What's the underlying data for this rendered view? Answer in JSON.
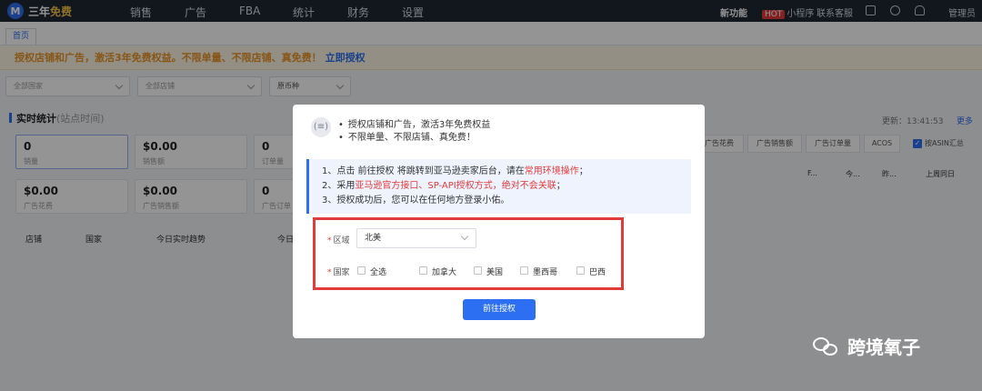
{
  "header": {
    "logo_mark": "M",
    "logo_text_a": "三年",
    "logo_text_b": "免费",
    "nav": [
      "销售",
      "广告",
      "FBA",
      "统计",
      "财务",
      "设置"
    ],
    "new_feature": "新功能",
    "hot_badge": "HOT",
    "mini_program": "小程序",
    "customer_service": "联系客服",
    "user": "管理员"
  },
  "tabs": [
    {
      "label": "首页"
    }
  ],
  "banner": {
    "text": "授权店铺和广告，激活3年免费权益。不限单量、不限店铺、真免费！",
    "link": "立即授权"
  },
  "filters": {
    "country": "全部国家",
    "store": "全部店铺",
    "currency": "原币种"
  },
  "stats": {
    "title": "实时统计",
    "subtitle": "(站点时间)",
    "cards": [
      {
        "value": "0",
        "label": "销量"
      },
      {
        "value": "$0.00",
        "label": "销售额"
      },
      {
        "value": "0",
        "label": "订单量"
      },
      {
        "value": "$0.00",
        "label": "广告花费"
      },
      {
        "value": "$0.00",
        "label": "广告销售额"
      },
      {
        "value": "0",
        "label": "广告订单"
      }
    ],
    "table_headers": [
      "店铺",
      "国家",
      "今日实时趋势",
      "今日"
    ]
  },
  "right_panel": {
    "update_label": "更新：",
    "update_time": "13:41:53",
    "more": "更多",
    "tabs": [
      "广告花费",
      "广告销售额",
      "广告订单量",
      "ACOS"
    ],
    "asin_summary": "按ASIN汇总",
    "headers": [
      "F...",
      "今...",
      "昨...",
      "上周同日"
    ]
  },
  "modal": {
    "bullets": [
      "授权店铺和广告，激活3年免费权益",
      "不限单量、不限店铺、真免费！"
    ],
    "info": {
      "line1_a": "1、点击 前往授权 将跳转到亚马逊卖家后台，请在",
      "line1_red": "常用环境操作",
      "line1_b": "；",
      "line2_a": "2、采用",
      "line2_red": "亚马逊官方接口、SP-API授权方式，绝对不会关联",
      "line2_b": "；",
      "line3": "3、授权成功后，您可以在任何地方登录小佑。"
    },
    "region_label": "区域",
    "region_value": "北美",
    "country_label": "国家",
    "countries": [
      "全选",
      "加拿大",
      "美国",
      "墨西哥",
      "巴西"
    ],
    "button": "前往授权"
  },
  "watermark": "跨境氧子"
}
